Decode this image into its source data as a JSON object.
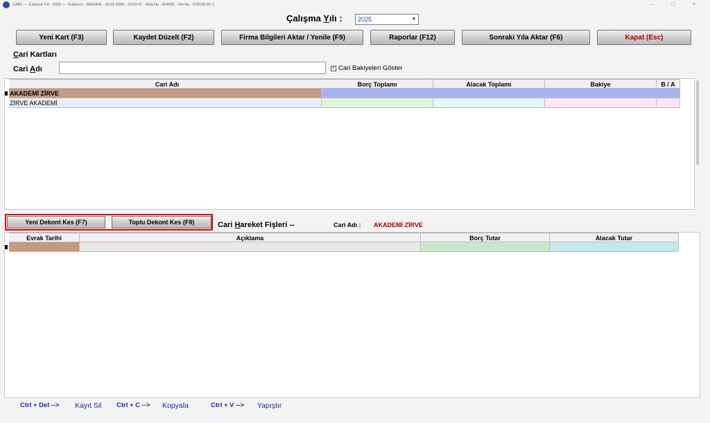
{
  "window": {
    "title": "CARİ  ----  Çalışma Yılı : 2025   ----   Kullanıcı : SERVER  -  16.01.2025  -  10:53:47   -  Müş.No : 424681  -  Ver.No : 070125-02.1"
  },
  "year": {
    "label_pre": "Çalışma ",
    "label_u": "Y",
    "label_post": "ılı :",
    "value": "2025"
  },
  "toolbar": {
    "new_card": "Yeni Kart (F3)",
    "save_edit": "Kaydet Düzelt (F2)",
    "company_info": "Firma Bilgileri Aktar / Yenile (F9)",
    "reports": "Raporlar (F12)",
    "next_year": "Sonraki Yıla Aktar (F6)",
    "close": "Kapat (Esc)"
  },
  "cards": {
    "title_pre": "",
    "title_u": "C",
    "title_post": "ari Kartları",
    "name_label_pre": "Cari ",
    "name_label_u": "A",
    "name_label_post": "dı",
    "name_value": "",
    "show_balances_label": "Cari Bakiyeleri Göster",
    "show_balances_checked": true,
    "columns": [
      "Cari Adı",
      "Borç Toplamı",
      "Alacak Toplamı",
      "Bakiye",
      "B / A"
    ],
    "rows": [
      {
        "name": "AKADEMİ ZİRVE",
        "debit": "",
        "credit": "",
        "balance": "",
        "ba": ""
      },
      {
        "name": "ZİRVE AKADEMİ",
        "debit": "",
        "credit": "",
        "balance": "",
        "ba": ""
      }
    ]
  },
  "movements": {
    "new_voucher": "Yeni Dekont Kes (F7)",
    "bulk_voucher": "Toplu Dekont Kes (F8)",
    "title_pre": "Cari ",
    "title_u": "H",
    "title_post": "areket Fişleri  --",
    "cari_label": "Cari Adı :",
    "cari_value": "AKADEMİ ZİRVE",
    "columns": [
      "Evrak Tarihi",
      "Açıklama",
      "Borç Tutar",
      "Alacak Tutar"
    ]
  },
  "footer": {
    "del_key": "Ctrl + Del -->",
    "del_action": "Kayıt Sil",
    "copy_key": "Ctrl + C -->",
    "copy_action": "Kopyala",
    "paste_key": "Ctrl + V -->",
    "paste_action": "Yapıştır"
  },
  "colors": {
    "close_text": "#b00000",
    "selected_row": "#c49a83",
    "debit_sel": "#a9b2f0",
    "debit_row": "#dcf6dc",
    "credit_row": "#dcf8fb",
    "balance_row": "#fbe5f7",
    "highlight": "#e00000"
  }
}
